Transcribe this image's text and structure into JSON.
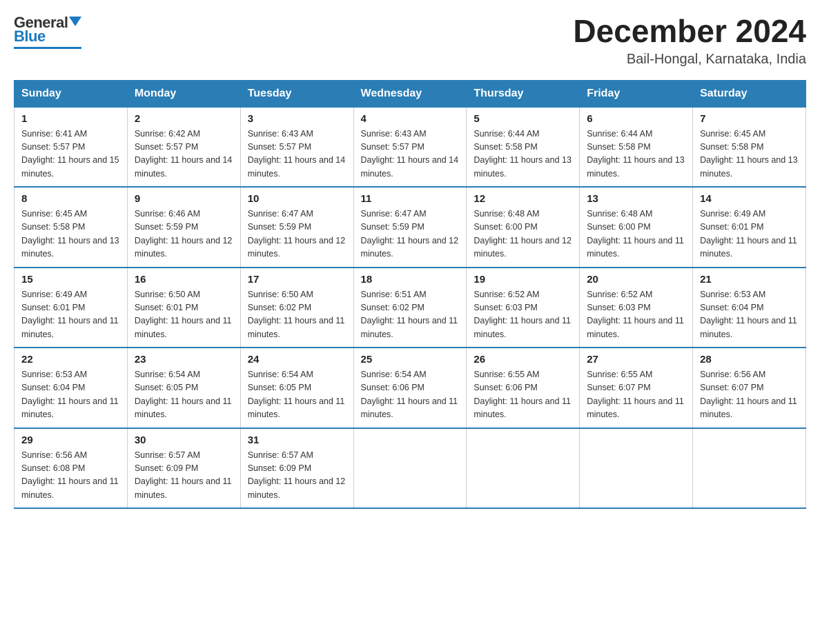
{
  "header": {
    "logo_general": "General",
    "logo_blue": "Blue",
    "month_title": "December 2024",
    "location": "Bail-Hongal, Karnataka, India"
  },
  "days_of_week": [
    "Sunday",
    "Monday",
    "Tuesday",
    "Wednesday",
    "Thursday",
    "Friday",
    "Saturday"
  ],
  "weeks": [
    [
      {
        "day": "1",
        "sunrise": "6:41 AM",
        "sunset": "5:57 PM",
        "daylight": "11 hours and 15 minutes."
      },
      {
        "day": "2",
        "sunrise": "6:42 AM",
        "sunset": "5:57 PM",
        "daylight": "11 hours and 14 minutes."
      },
      {
        "day": "3",
        "sunrise": "6:43 AM",
        "sunset": "5:57 PM",
        "daylight": "11 hours and 14 minutes."
      },
      {
        "day": "4",
        "sunrise": "6:43 AM",
        "sunset": "5:57 PM",
        "daylight": "11 hours and 14 minutes."
      },
      {
        "day": "5",
        "sunrise": "6:44 AM",
        "sunset": "5:58 PM",
        "daylight": "11 hours and 13 minutes."
      },
      {
        "day": "6",
        "sunrise": "6:44 AM",
        "sunset": "5:58 PM",
        "daylight": "11 hours and 13 minutes."
      },
      {
        "day": "7",
        "sunrise": "6:45 AM",
        "sunset": "5:58 PM",
        "daylight": "11 hours and 13 minutes."
      }
    ],
    [
      {
        "day": "8",
        "sunrise": "6:45 AM",
        "sunset": "5:58 PM",
        "daylight": "11 hours and 13 minutes."
      },
      {
        "day": "9",
        "sunrise": "6:46 AM",
        "sunset": "5:59 PM",
        "daylight": "11 hours and 12 minutes."
      },
      {
        "day": "10",
        "sunrise": "6:47 AM",
        "sunset": "5:59 PM",
        "daylight": "11 hours and 12 minutes."
      },
      {
        "day": "11",
        "sunrise": "6:47 AM",
        "sunset": "5:59 PM",
        "daylight": "11 hours and 12 minutes."
      },
      {
        "day": "12",
        "sunrise": "6:48 AM",
        "sunset": "6:00 PM",
        "daylight": "11 hours and 12 minutes."
      },
      {
        "day": "13",
        "sunrise": "6:48 AM",
        "sunset": "6:00 PM",
        "daylight": "11 hours and 11 minutes."
      },
      {
        "day": "14",
        "sunrise": "6:49 AM",
        "sunset": "6:01 PM",
        "daylight": "11 hours and 11 minutes."
      }
    ],
    [
      {
        "day": "15",
        "sunrise": "6:49 AM",
        "sunset": "6:01 PM",
        "daylight": "11 hours and 11 minutes."
      },
      {
        "day": "16",
        "sunrise": "6:50 AM",
        "sunset": "6:01 PM",
        "daylight": "11 hours and 11 minutes."
      },
      {
        "day": "17",
        "sunrise": "6:50 AM",
        "sunset": "6:02 PM",
        "daylight": "11 hours and 11 minutes."
      },
      {
        "day": "18",
        "sunrise": "6:51 AM",
        "sunset": "6:02 PM",
        "daylight": "11 hours and 11 minutes."
      },
      {
        "day": "19",
        "sunrise": "6:52 AM",
        "sunset": "6:03 PM",
        "daylight": "11 hours and 11 minutes."
      },
      {
        "day": "20",
        "sunrise": "6:52 AM",
        "sunset": "6:03 PM",
        "daylight": "11 hours and 11 minutes."
      },
      {
        "day": "21",
        "sunrise": "6:53 AM",
        "sunset": "6:04 PM",
        "daylight": "11 hours and 11 minutes."
      }
    ],
    [
      {
        "day": "22",
        "sunrise": "6:53 AM",
        "sunset": "6:04 PM",
        "daylight": "11 hours and 11 minutes."
      },
      {
        "day": "23",
        "sunrise": "6:54 AM",
        "sunset": "6:05 PM",
        "daylight": "11 hours and 11 minutes."
      },
      {
        "day": "24",
        "sunrise": "6:54 AM",
        "sunset": "6:05 PM",
        "daylight": "11 hours and 11 minutes."
      },
      {
        "day": "25",
        "sunrise": "6:54 AM",
        "sunset": "6:06 PM",
        "daylight": "11 hours and 11 minutes."
      },
      {
        "day": "26",
        "sunrise": "6:55 AM",
        "sunset": "6:06 PM",
        "daylight": "11 hours and 11 minutes."
      },
      {
        "day": "27",
        "sunrise": "6:55 AM",
        "sunset": "6:07 PM",
        "daylight": "11 hours and 11 minutes."
      },
      {
        "day": "28",
        "sunrise": "6:56 AM",
        "sunset": "6:07 PM",
        "daylight": "11 hours and 11 minutes."
      }
    ],
    [
      {
        "day": "29",
        "sunrise": "6:56 AM",
        "sunset": "6:08 PM",
        "daylight": "11 hours and 11 minutes."
      },
      {
        "day": "30",
        "sunrise": "6:57 AM",
        "sunset": "6:09 PM",
        "daylight": "11 hours and 11 minutes."
      },
      {
        "day": "31",
        "sunrise": "6:57 AM",
        "sunset": "6:09 PM",
        "daylight": "11 hours and 12 minutes."
      },
      null,
      null,
      null,
      null
    ]
  ],
  "labels": {
    "sunrise": "Sunrise:",
    "sunset": "Sunset:",
    "daylight": "Daylight:"
  }
}
